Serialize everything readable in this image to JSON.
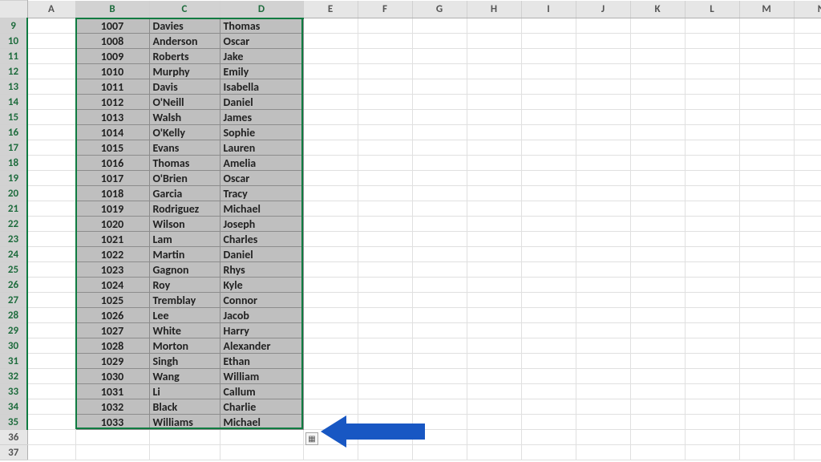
{
  "columns": [
    "A",
    "B",
    "C",
    "D",
    "E",
    "F",
    "G",
    "H",
    "I",
    "J",
    "K",
    "L",
    "M",
    "N"
  ],
  "selected_columns": [
    "B",
    "C",
    "D"
  ],
  "row_start": 9,
  "row_end": 37,
  "selected_rows": [
    9,
    10,
    11,
    12,
    13,
    14,
    15,
    16,
    17,
    18,
    19,
    20,
    21,
    22,
    23,
    24,
    25,
    26,
    27,
    28,
    29,
    30,
    31,
    32,
    33,
    34,
    35
  ],
  "rows": [
    {
      "row": 9,
      "B": "1007",
      "C": "Davies",
      "D": "Thomas"
    },
    {
      "row": 10,
      "B": "1008",
      "C": "Anderson",
      "D": "Oscar"
    },
    {
      "row": 11,
      "B": "1009",
      "C": "Roberts",
      "D": "Jake"
    },
    {
      "row": 12,
      "B": "1010",
      "C": "Murphy",
      "D": "Emily"
    },
    {
      "row": 13,
      "B": "1011",
      "C": "Davis",
      "D": "Isabella"
    },
    {
      "row": 14,
      "B": "1012",
      "C": "O'Neill",
      "D": "Daniel"
    },
    {
      "row": 15,
      "B": "1013",
      "C": "Walsh",
      "D": "James"
    },
    {
      "row": 16,
      "B": "1014",
      "C": "O'Kelly",
      "D": "Sophie"
    },
    {
      "row": 17,
      "B": "1015",
      "C": "Evans",
      "D": "Lauren"
    },
    {
      "row": 18,
      "B": "1016",
      "C": "Thomas",
      "D": "Amelia"
    },
    {
      "row": 19,
      "B": "1017",
      "C": "O'Brien",
      "D": "Oscar"
    },
    {
      "row": 20,
      "B": "1018",
      "C": "Garcia",
      "D": "Tracy"
    },
    {
      "row": 21,
      "B": "1019",
      "C": "Rodriguez",
      "D": "Michael"
    },
    {
      "row": 22,
      "B": "1020",
      "C": "Wilson",
      "D": "Joseph"
    },
    {
      "row": 23,
      "B": "1021",
      "C": "Lam",
      "D": "Charles"
    },
    {
      "row": 24,
      "B": "1022",
      "C": "Martin",
      "D": "Daniel"
    },
    {
      "row": 25,
      "B": "1023",
      "C": "Gagnon",
      "D": "Rhys"
    },
    {
      "row": 26,
      "B": "1024",
      "C": "Roy",
      "D": "Kyle"
    },
    {
      "row": 27,
      "B": "1025",
      "C": "Tremblay",
      "D": "Connor"
    },
    {
      "row": 28,
      "B": "1026",
      "C": "Lee",
      "D": "Jacob"
    },
    {
      "row": 29,
      "B": "1027",
      "C": "White",
      "D": "Harry"
    },
    {
      "row": 30,
      "B": "1028",
      "C": "Morton",
      "D": "Alexander"
    },
    {
      "row": 31,
      "B": "1029",
      "C": "Singh",
      "D": "Ethan"
    },
    {
      "row": 32,
      "B": "1030",
      "C": "Wang",
      "D": "William"
    },
    {
      "row": 33,
      "B": "1031",
      "C": "Li",
      "D": "Callum"
    },
    {
      "row": 34,
      "B": "1032",
      "C": "Black",
      "D": "Charlie"
    },
    {
      "row": 35,
      "B": "1033",
      "C": "Williams",
      "D": "Michael"
    },
    {
      "row": 36
    },
    {
      "row": 37
    }
  ],
  "paste_options_glyph": "▦",
  "colors": {
    "selection_border": "#0f7b41",
    "arrow": "#1857c3"
  }
}
